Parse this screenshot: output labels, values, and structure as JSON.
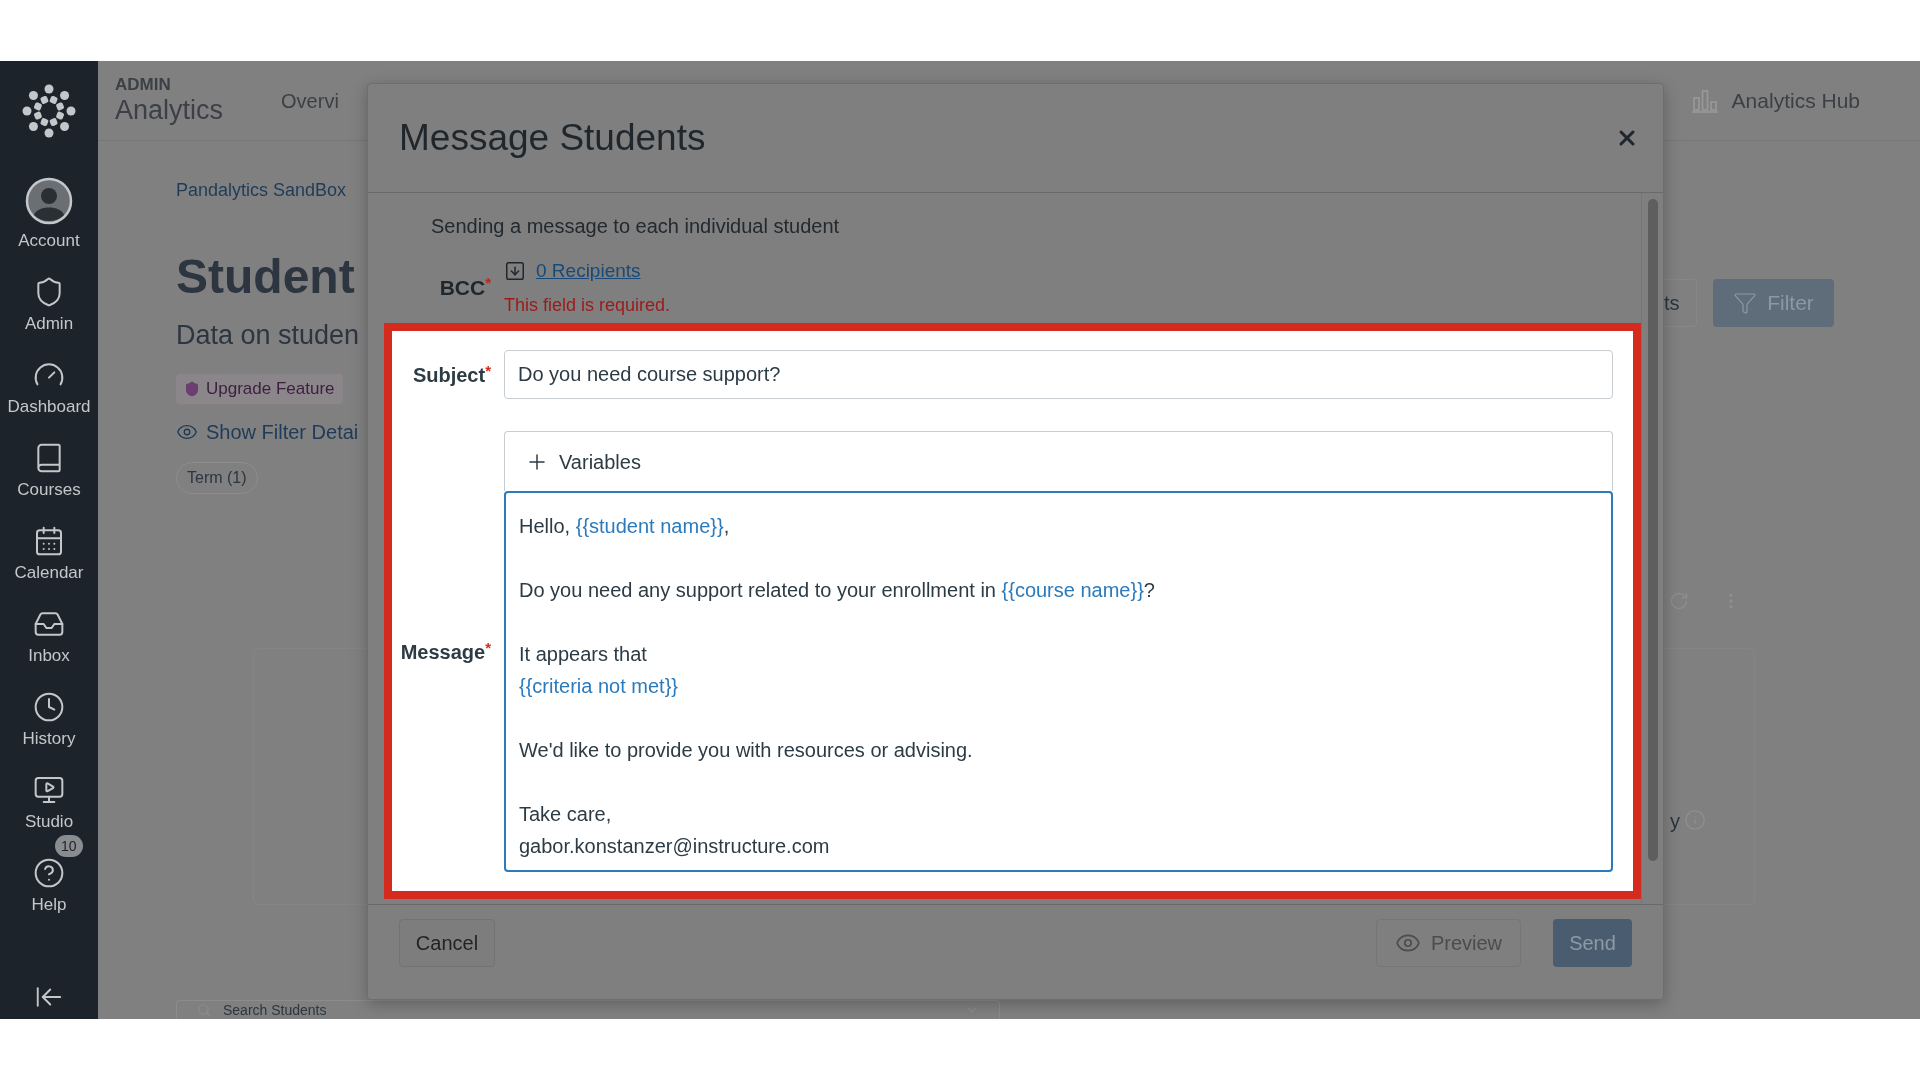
{
  "sidebar": {
    "items": [
      {
        "label": "Account"
      },
      {
        "label": "Admin"
      },
      {
        "label": "Dashboard"
      },
      {
        "label": "Courses"
      },
      {
        "label": "Calendar"
      },
      {
        "label": "Inbox"
      },
      {
        "label": "History"
      },
      {
        "label": "Studio"
      },
      {
        "label": "Help",
        "badge": "10"
      }
    ]
  },
  "header": {
    "eyebrow": "ADMIN",
    "title": "Analytics",
    "nav_item": "Overvi",
    "hub_link": "Analytics Hub"
  },
  "page": {
    "breadcrumb": "Pandalytics SandBox",
    "heading": "Student",
    "subheading": "Data on studen",
    "upgrade_badge": "Upgrade Feature",
    "filter_details_link": "Show Filter Detai",
    "term_chip": "Term (1)",
    "button_fragment": "ts",
    "filter_button": "Filter",
    "card_fragment": "y",
    "search_placeholder": "Search Students"
  },
  "dialog": {
    "title": "Message Students",
    "intro": "Sending a message to each individual student",
    "bcc": {
      "label": "BCC",
      "required_mark": "*",
      "recipients": "0 Recipients",
      "error": "This field is required."
    },
    "subject": {
      "label": "Subject",
      "required_mark": "*",
      "value": "Do you need course support?"
    },
    "variables_toggle": "Variables",
    "message": {
      "label": "Message",
      "required_mark": "*",
      "focused": true,
      "paragraphs": [
        [
          [
            {
              "kind": "text",
              "text": "Hello, "
            },
            {
              "kind": "variable",
              "text": "{{student name}}"
            },
            {
              "kind": "text",
              "text": ","
            }
          ]
        ],
        [
          [
            {
              "kind": "text",
              "text": "Do you need any support related to your enrollment in "
            },
            {
              "kind": "variable",
              "text": "{{course name}}"
            },
            {
              "kind": "text",
              "text": "?"
            }
          ]
        ],
        [
          [
            {
              "kind": "text",
              "text": "It appears that"
            }
          ],
          [
            {
              "kind": "variable",
              "text": "{{criteria not met}}"
            }
          ]
        ],
        [
          [
            {
              "kind": "text",
              "text": "We'd like to provide you with resources or advising."
            }
          ]
        ],
        [
          [
            {
              "kind": "text",
              "text": "Take care,"
            }
          ],
          [
            {
              "kind": "text",
              "text": "gabor.konstanzer@instructure.com"
            }
          ]
        ]
      ]
    },
    "buttons": {
      "cancel": "Cancel",
      "preview": "Preview",
      "send": "Send"
    }
  }
}
